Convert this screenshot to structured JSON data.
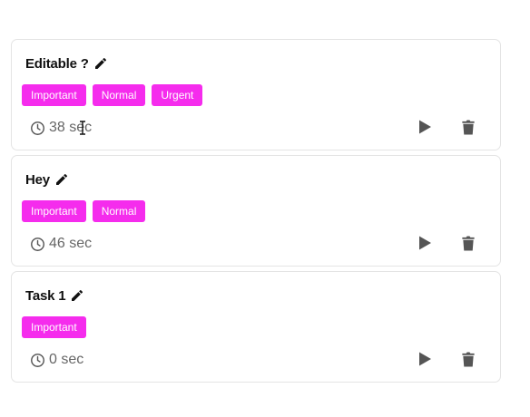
{
  "tasks": [
    {
      "title": "Editable ?",
      "tags": [
        "Important",
        "Normal",
        "Urgent"
      ],
      "time": "38 sec"
    },
    {
      "title": "Hey",
      "tags": [
        "Important",
        "Normal"
      ],
      "time": "46 sec"
    },
    {
      "title": "Task 1",
      "tags": [
        "Important"
      ],
      "time": "0 sec"
    }
  ],
  "icons": {
    "edit": "pencil-icon",
    "clock": "clock-icon",
    "play": "play-icon",
    "delete": "trash-icon"
  },
  "colors": {
    "tag_background": "#f52ced",
    "tag_text": "#ffffff",
    "icon_gray": "#555555",
    "time_text": "#666666"
  }
}
